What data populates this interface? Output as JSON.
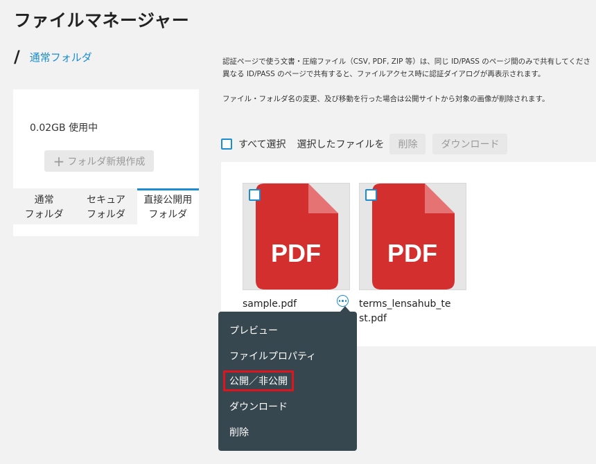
{
  "header": {
    "title": "ファイルマネージャー"
  },
  "breadcrumb": {
    "separator": "/",
    "current": "通常フォルダ"
  },
  "sidebar": {
    "usage": "0.02GB 使用中",
    "new_folder_label": "フォルダ新規作成",
    "tabs": [
      {
        "line1": "通常",
        "line2": "フォルダ",
        "active": false
      },
      {
        "line1": "セキュア",
        "line2": "フォルダ",
        "active": false
      },
      {
        "line1": "直接公開用",
        "line2": "フォルダ",
        "active": true
      }
    ]
  },
  "notice": {
    "line1": "認証ページで使う文書・圧縮ファイル（CSV, PDF, ZIP 等）は、同じ ID/PASS のページ間のみで共有してくださ",
    "line2": "異なる ID/PASS のページで共有すると、ファイルアクセス時に認証ダイアログが再表示されます。",
    "line3": "ファイル・フォルダ名の変更、及び移動を行った場合は公開サイトから対象の画像が削除されます。"
  },
  "toolbar": {
    "select_all": "すべて選択",
    "selected_files": "選択したファイルを",
    "delete": "削除",
    "download": "ダウンロード"
  },
  "files": [
    {
      "name": "sample.pdf",
      "icon_label": "PDF"
    },
    {
      "name": "terms_lensahub_test.pdf",
      "icon_label": "PDF"
    }
  ],
  "context_menu": {
    "items": [
      "プレビュー",
      "ファイルプロパティ",
      "公開／非公開",
      "ダウンロード",
      "削除"
    ]
  },
  "colors": {
    "accent": "#1a8ccf",
    "pdf_red": "#d32f2f",
    "menu_bg": "#37474f",
    "highlight": "#e0141e"
  }
}
